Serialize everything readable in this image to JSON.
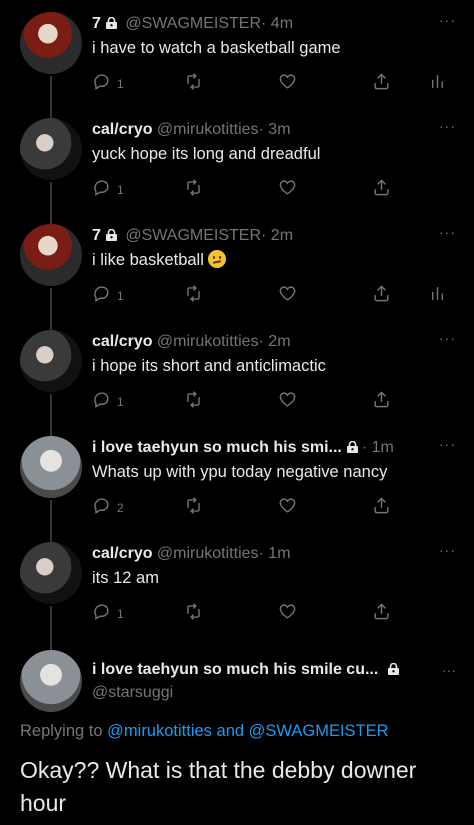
{
  "tweets": [
    {
      "name": "7",
      "handle": "@SWAGMEISTER",
      "time": "· 4m",
      "text": "i have to watch a basketball game",
      "reply_count": "1",
      "locked": true,
      "avatar": "red-anime-avatar",
      "last_action": "analytics-icon"
    },
    {
      "name": "cal/cryo",
      "handle": "@mirukotitties",
      "time": "· 3m",
      "text": "yuck hope its long and dreadful",
      "reply_count": "1",
      "locked": false,
      "avatar": "photo-avatar",
      "last_action": "share-icon"
    },
    {
      "name": "7",
      "handle": "@SWAGMEISTER",
      "time": "· 2m",
      "text": "i like basketball",
      "emoji": "confused-face",
      "reply_count": "1",
      "locked": true,
      "avatar": "red-anime-avatar",
      "last_action": "analytics-icon"
    },
    {
      "name": "cal/cryo",
      "handle": "@mirukotitties",
      "time": "· 2m",
      "text": "i hope its short and anticlimactic",
      "reply_count": "1",
      "locked": false,
      "avatar": "photo-avatar",
      "last_action": "share-icon"
    },
    {
      "name": "i love taehyun so much his smi...",
      "handle": "",
      "time": "· 1m",
      "text": "Whats up with ypu today negative nancy",
      "reply_count": "2",
      "locked": true,
      "avatar": "photo-avatar-light",
      "last_action": "share-icon"
    },
    {
      "name": "cal/cryo",
      "handle": "@mirukotitties",
      "time": "· 1m",
      "text": "its 12 am",
      "reply_count": "1",
      "locked": false,
      "avatar": "photo-avatar",
      "last_action": "share-icon"
    }
  ],
  "main_tweet": {
    "name": "i love taehyun so much his smile cu...",
    "handle": "@starsuggi",
    "replying_prefix": "Replying to",
    "mention1": "@mirukotitties",
    "and": "and",
    "mention2": "@SWAGMEISTER",
    "text": "Okay?? What is that the debby downer hour"
  },
  "more_label": "···",
  "colors": {
    "background": "#000000",
    "text": "#e7e9ea",
    "muted": "#71767b",
    "accent": "#1d9bf0"
  }
}
